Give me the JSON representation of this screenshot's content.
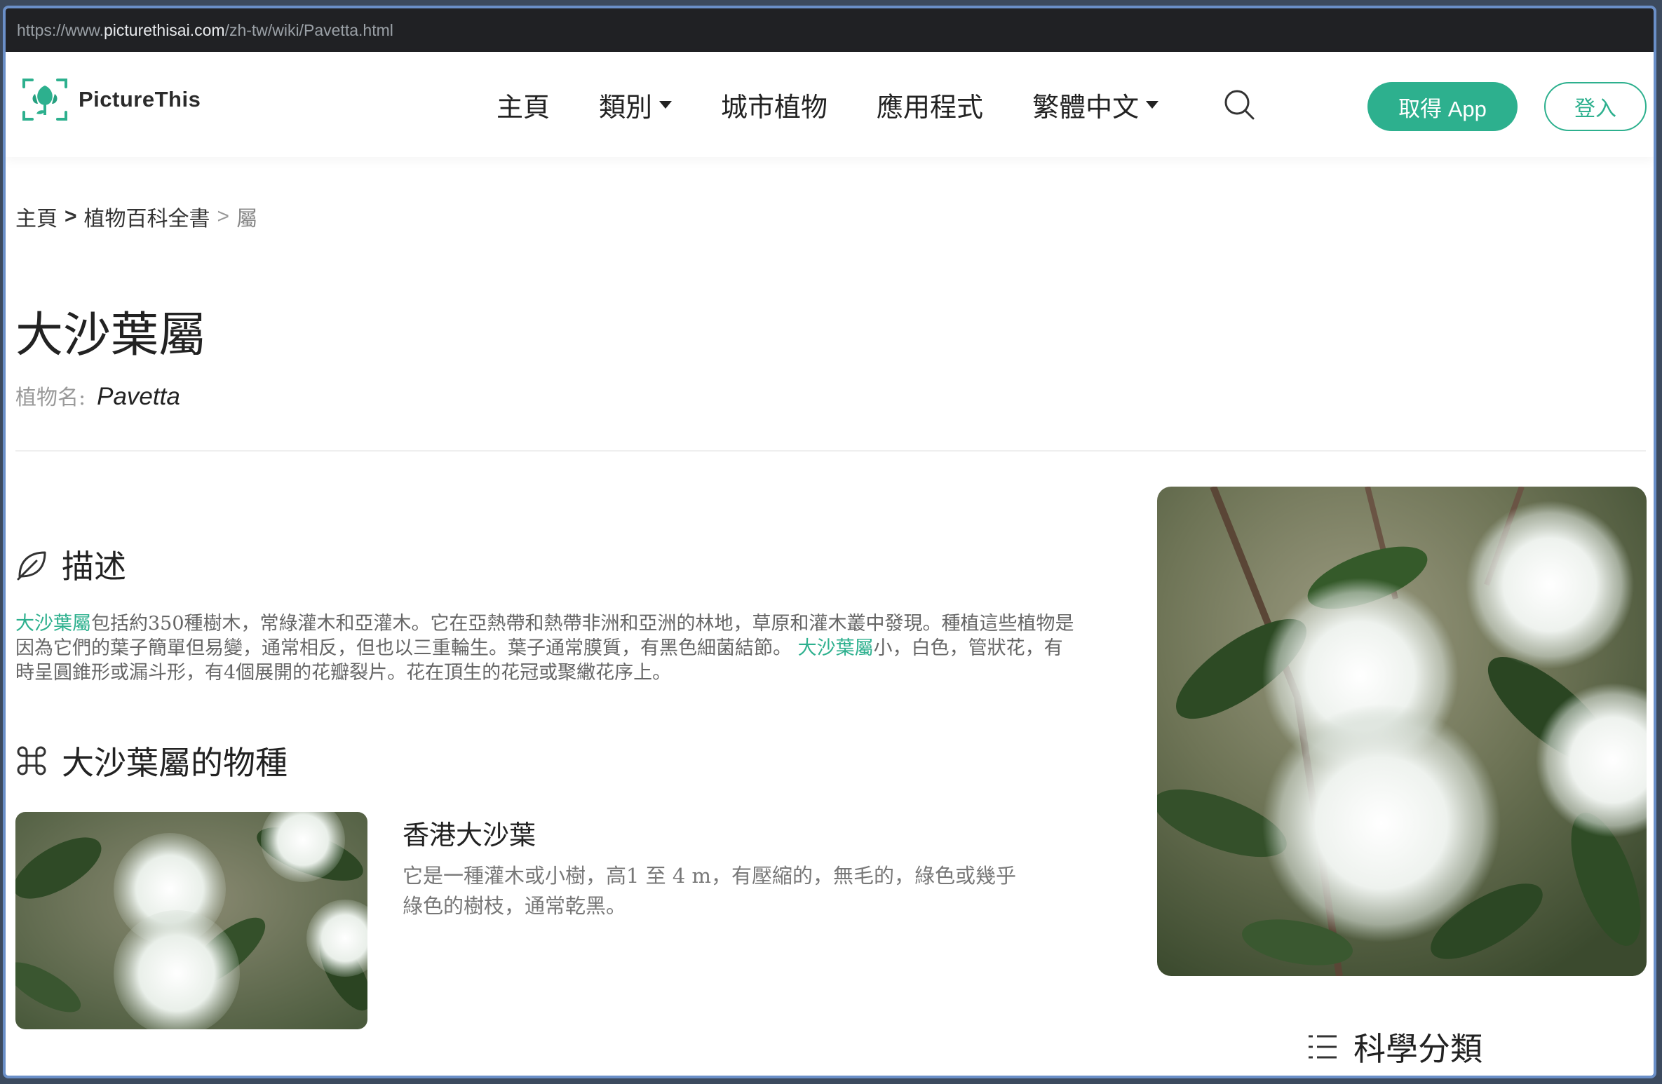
{
  "browser": {
    "url_prefix": "https://www.",
    "url_host": "picturethisai.com",
    "url_path": "/zh-tw/wiki/Pavetta.html"
  },
  "nav": {
    "brand": "PictureThis",
    "items": [
      {
        "label": "主頁"
      },
      {
        "label": "類別"
      },
      {
        "label": "城市植物"
      },
      {
        "label": "應用程式"
      },
      {
        "label": "繁體中文"
      }
    ],
    "get_app": "取得 App",
    "login": "登入"
  },
  "breadcrumb": {
    "home": "主頁",
    "sep1": ">",
    "encyclopedia": "植物百科全書",
    "sep2": ">",
    "current": "屬"
  },
  "page": {
    "title": "大沙葉屬",
    "plant_name_label": "植物名:",
    "plant_name_value": "Pavetta"
  },
  "description": {
    "heading": "描述",
    "hl1": "大沙葉屬",
    "text1": "包括約350種樹木，常綠灌木和亞灌木。它在亞熱帶和熱帶非洲和亞洲的林地，草原和灌木叢中發現。種植這些植物是因為它們的葉子簡單但易變，通常相反，但也以三重輪生。葉子通常膜質，有黑色細菌結節。",
    "hl2": "大沙葉屬",
    "text2": "小，白色，管狀花，有時呈圓錐形或漏斗形，有4個展開的花瓣裂片。花在頂生的花冠或聚繖花序上。"
  },
  "species": {
    "heading": "大沙葉屬的物種",
    "items": [
      {
        "name": "香港大沙葉",
        "desc": "它是一種灌木或小樹，高1 至 4 m，有壓縮的，無毛的，綠色或幾乎綠色的樹枝，通常乾黑。"
      }
    ]
  },
  "taxonomy": {
    "heading": "科學分類"
  },
  "colors": {
    "accent": "#2db08e",
    "text": "#222222",
    "muted": "#777777"
  }
}
